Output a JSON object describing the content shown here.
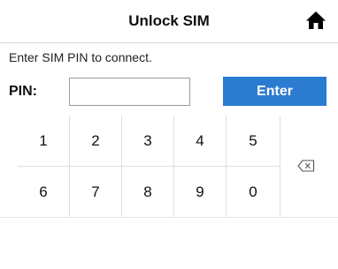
{
  "header": {
    "title": "Unlock SIM",
    "home_icon": "home-icon"
  },
  "main": {
    "prompt": "Enter SIM PIN to connect.",
    "pin_label": "PIN:",
    "pin_value": "",
    "pin_placeholder": "",
    "enter_label": "Enter"
  },
  "keypad": {
    "row1": [
      "1",
      "2",
      "3",
      "4",
      "5"
    ],
    "row2": [
      "6",
      "7",
      "8",
      "9",
      "0"
    ],
    "delete_icon": "backspace-icon"
  },
  "colors": {
    "accent": "#2b7bd1",
    "divider": "#dedede"
  }
}
